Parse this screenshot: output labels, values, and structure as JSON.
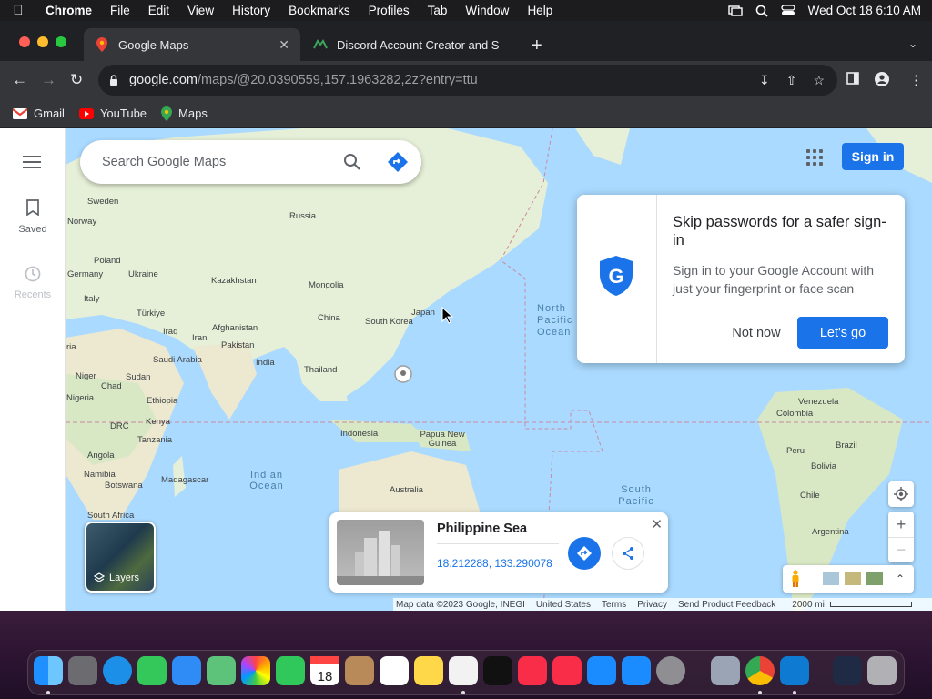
{
  "menubar": {
    "app": "Chrome",
    "items": [
      "File",
      "Edit",
      "View",
      "History",
      "Bookmarks",
      "Profiles",
      "Tab",
      "Window",
      "Help"
    ],
    "datetime": "Wed Oct 18  6:10 AM"
  },
  "tabs": [
    {
      "label": "Google Maps"
    },
    {
      "label": "Discord Account Creator and S"
    }
  ],
  "omnibox": {
    "host": "google.com",
    "path": "/maps/@20.0390559,157.1963282,2z?entry=ttu"
  },
  "bookmarks": [
    {
      "label": "Gmail"
    },
    {
      "label": "YouTube"
    },
    {
      "label": "Maps"
    }
  ],
  "rail": {
    "saved": "Saved",
    "recents": "Recents"
  },
  "search": {
    "placeholder": "Search Google Maps"
  },
  "header": {
    "signin": "Sign in"
  },
  "map_labels": [
    {
      "text": "Sweden"
    },
    {
      "text": "Norway"
    },
    {
      "text": "Russia"
    },
    {
      "text": "Poland"
    },
    {
      "text": "Germany"
    },
    {
      "text": "Ukraine"
    },
    {
      "text": "Kazakhstan"
    },
    {
      "text": "Mongolia"
    },
    {
      "text": "Italy"
    },
    {
      "text": "Türkiye"
    },
    {
      "text": "China"
    },
    {
      "text": "South Korea"
    },
    {
      "text": "Japan"
    },
    {
      "text": "Iraq"
    },
    {
      "text": "Afghanistan"
    },
    {
      "text": "Iran"
    },
    {
      "text": "Pakistan"
    },
    {
      "text": "Saudi Arabia"
    },
    {
      "text": "India"
    },
    {
      "text": "Thailand"
    },
    {
      "text": "Niger"
    },
    {
      "text": "Sudan"
    },
    {
      "text": "Chad"
    },
    {
      "text": "Nigeria"
    },
    {
      "text": "Ethiopia"
    },
    {
      "text": "DRC"
    },
    {
      "text": "Kenya"
    },
    {
      "text": "Tanzania"
    },
    {
      "text": "Indonesia"
    },
    {
      "text": "Papua New Guinea"
    },
    {
      "text": "Angola"
    },
    {
      "text": "Namibia"
    },
    {
      "text": "Botswana"
    },
    {
      "text": "Madagascar"
    },
    {
      "text": "South Africa"
    },
    {
      "text": "Australia"
    },
    {
      "text": "Indian Ocean"
    },
    {
      "text": "North Pacific Ocean"
    },
    {
      "text": "South Pacific"
    },
    {
      "text": "Venezuela"
    },
    {
      "text": "Colombia"
    },
    {
      "text": "Peru"
    },
    {
      "text": "Brazil"
    },
    {
      "text": "Bolivia"
    },
    {
      "text": "Chile"
    },
    {
      "text": "Argentina"
    },
    {
      "text": "ria"
    }
  ],
  "popup": {
    "title": "Skip passwords for a safer sign-in",
    "body": "Sign in to your Google Account with just your fingerprint or face scan",
    "not_now": "Not now",
    "lets_go": "Let's go"
  },
  "layers": {
    "label": "Layers"
  },
  "place": {
    "name": "Philippine Sea",
    "coords": "18.212288, 133.290078"
  },
  "footer": {
    "items": [
      "Map data ©2023 Google, INEGI",
      "United States",
      "Terms",
      "Privacy",
      "Send Product Feedback"
    ],
    "scale": "2000 mi"
  },
  "colors": {
    "accent": "#1a73e8",
    "water": "#aadaff",
    "land": "#e8f0d8"
  }
}
